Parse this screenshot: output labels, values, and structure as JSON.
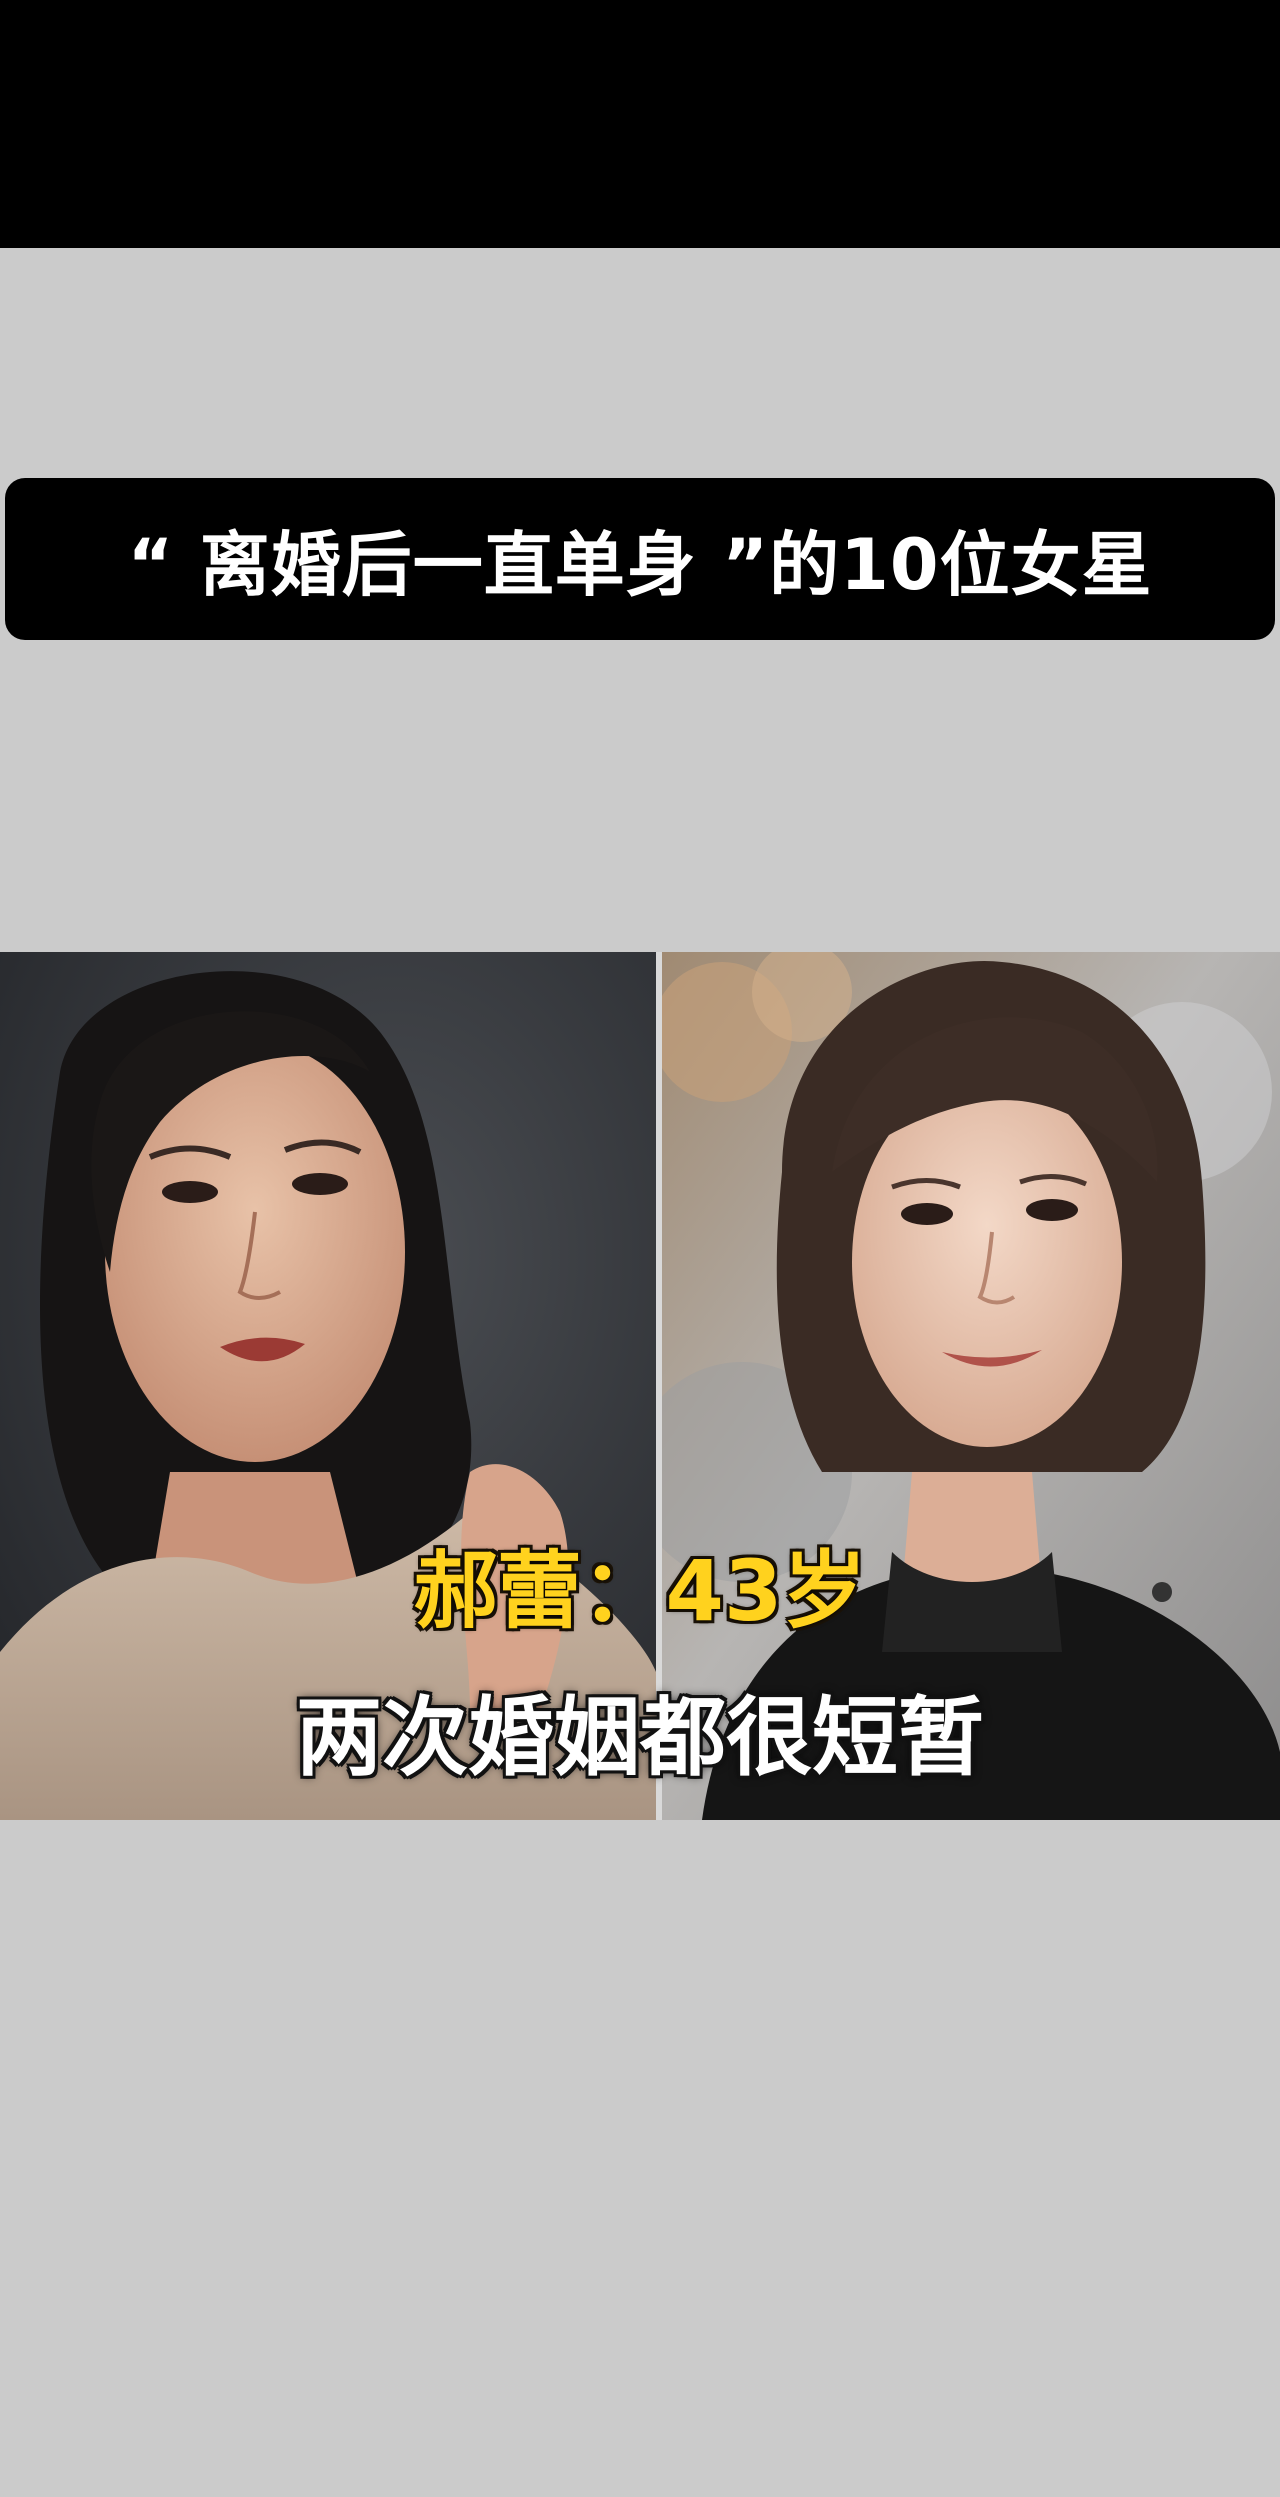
{
  "banner": {
    "title": "“ 离婚后一直单身 ”的10位女星"
  },
  "captions": {
    "name_age": "郝蕾：43岁",
    "description": "两次婚姻都很短暂"
  },
  "colors": {
    "background": "#cbcbcb",
    "banner": "#000000",
    "name_caption": "#ffd21e",
    "desc_caption": "#ffffff"
  }
}
